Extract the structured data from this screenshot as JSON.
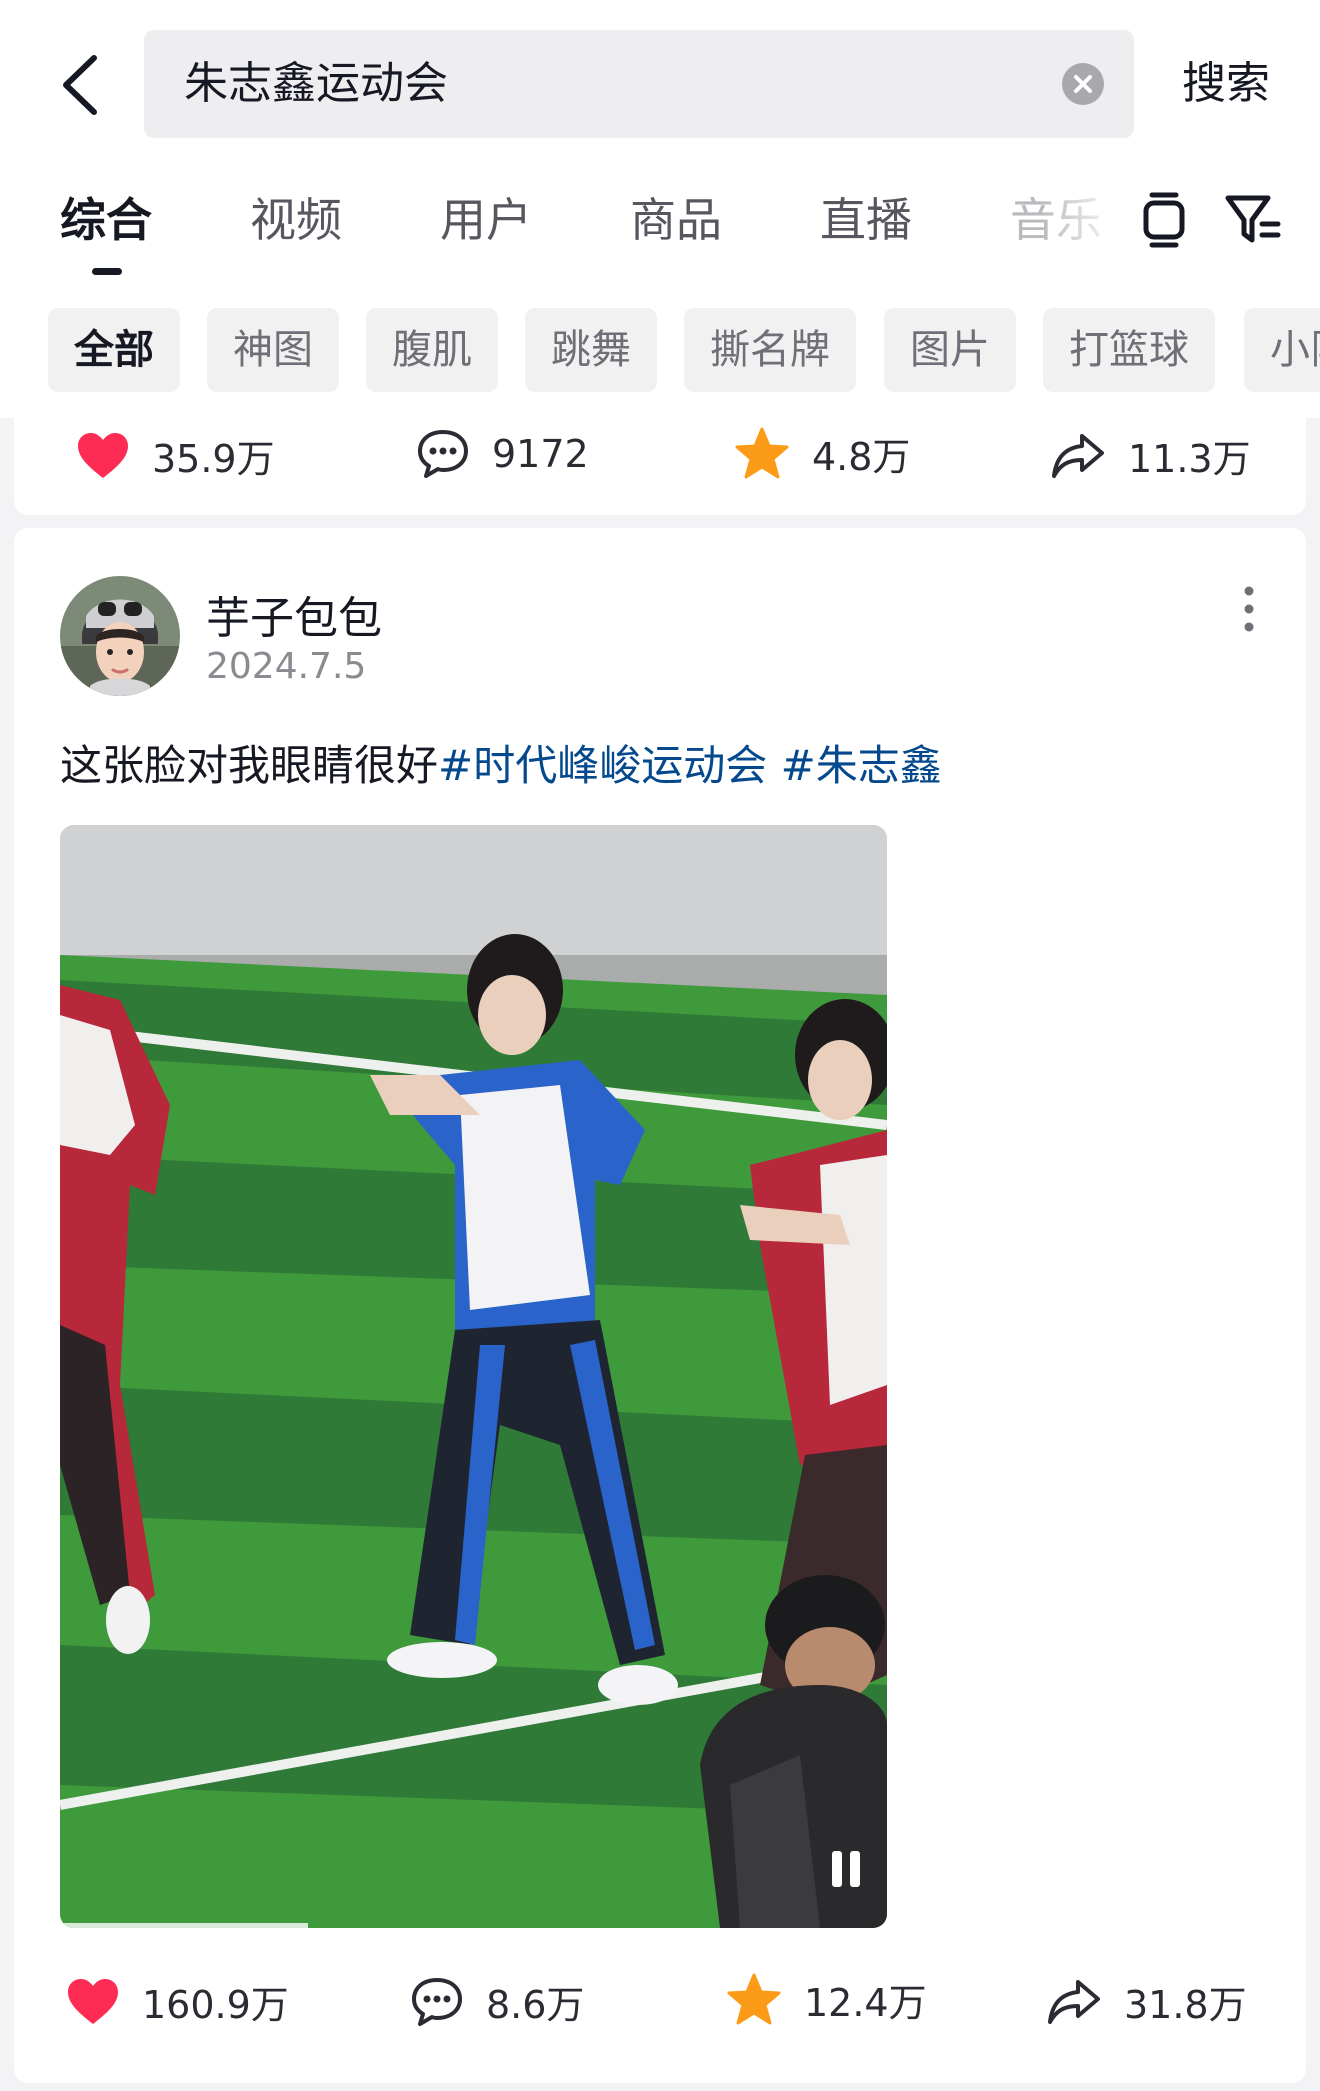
{
  "search": {
    "query": "朱志鑫运动会",
    "button_label": "搜索"
  },
  "tabs": [
    {
      "label": "综合",
      "active": true
    },
    {
      "label": "视频"
    },
    {
      "label": "用户"
    },
    {
      "label": "商品"
    },
    {
      "label": "直播"
    },
    {
      "label": "音乐"
    }
  ],
  "chips": [
    {
      "label": "全部",
      "active": true
    },
    {
      "label": "神图"
    },
    {
      "label": "腹肌"
    },
    {
      "label": "跳舞"
    },
    {
      "label": "撕名牌"
    },
    {
      "label": "图片"
    },
    {
      "label": "打篮球"
    },
    {
      "label": "小队"
    }
  ],
  "card1": {
    "likes": "35.9万",
    "comments": "9172",
    "favorites": "4.8万",
    "shares": "11.3万"
  },
  "card2": {
    "author": "芋子包包",
    "date": "2024.7.5",
    "caption_text": "这张脸对我眼睛很好",
    "hashtags": [
      "#时代峰峻运动会",
      "#朱志鑫"
    ],
    "video_progress": 0.3,
    "likes": "160.9万",
    "comments": "8.6万",
    "favorites": "12.4万",
    "shares": "31.8万"
  },
  "colors": {
    "like": "#fe2c55",
    "favorite": "#fb9b18",
    "hashtag": "#04498d",
    "active_text": "#161823"
  },
  "icons": [
    "back-arrow-icon",
    "clear-icon",
    "watch-icon",
    "filter-icon",
    "heart-icon",
    "comment-icon",
    "star-icon",
    "share-icon",
    "more-icon",
    "pause-icon"
  ]
}
